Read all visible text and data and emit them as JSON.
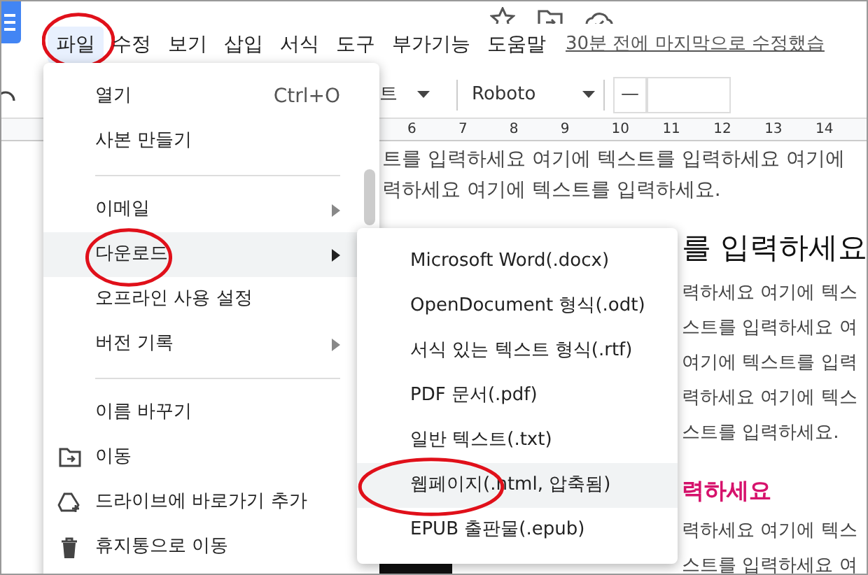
{
  "menubar": {
    "items": [
      {
        "label": "파일",
        "selected": true,
        "circled": true
      },
      {
        "label": "수정",
        "selected": false,
        "circled": false
      },
      {
        "label": "보기",
        "selected": false,
        "circled": false
      },
      {
        "label": "삽입",
        "selected": false,
        "circled": false
      },
      {
        "label": "서식",
        "selected": false,
        "circled": false
      },
      {
        "label": "도구",
        "selected": false,
        "circled": false
      },
      {
        "label": "부가기능",
        "selected": false,
        "circled": false
      },
      {
        "label": "도움말",
        "selected": false,
        "circled": false
      }
    ],
    "last_edit": "30분 전에 마지막으로 수정했습"
  },
  "toolbar": {
    "style_dropdown": "트",
    "font_dropdown": "Roboto",
    "font_size_minus": "—"
  },
  "ruler": [
    "6",
    "7",
    "8",
    "9",
    "10",
    "11",
    "12",
    "13",
    "14"
  ],
  "document": {
    "lines": [
      {
        "kind": "body",
        "text": "트를 입력하세요 여기에 텍스트를 입력하세요 여기에"
      },
      {
        "kind": "body",
        "text": "력하세요 여기에 텍스트를 입력하세요."
      },
      {
        "kind": "heading",
        "text": "를 입력하세요"
      },
      {
        "kind": "side",
        "text": "력하세요 여기에 텍스"
      },
      {
        "kind": "side",
        "text": "스트를 입력하세요 여"
      },
      {
        "kind": "side",
        "text": "여기에 텍스트를 입력"
      },
      {
        "kind": "side",
        "text": "력하세요 여기에 텍스"
      },
      {
        "kind": "side",
        "text": "스트를 입력하세요."
      },
      {
        "kind": "side_heading",
        "text": "력하세요"
      },
      {
        "kind": "side",
        "text": "력하세요 여기에 텍스"
      },
      {
        "kind": "side",
        "text": "스트를 입력하세요 여"
      }
    ]
  },
  "file_menu": {
    "items": [
      {
        "kind": "plain",
        "label": "열기",
        "shortcut": "Ctrl+O",
        "submenu": false,
        "selected": false,
        "circled": false
      },
      {
        "kind": "plain",
        "label": "사본 만들기",
        "submenu": false,
        "selected": false,
        "circled": false
      },
      {
        "kind": "divider"
      },
      {
        "kind": "plain",
        "label": "이메일",
        "submenu": true,
        "selected": false,
        "circled": false
      },
      {
        "kind": "plain",
        "label": "다운로드",
        "submenu": true,
        "selected": true,
        "circled": true
      },
      {
        "kind": "plain",
        "label": "오프라인 사용 설정",
        "submenu": false,
        "selected": false,
        "circled": false
      },
      {
        "kind": "plain",
        "label": "버전 기록",
        "submenu": true,
        "selected": false,
        "circled": false
      },
      {
        "kind": "divider"
      },
      {
        "kind": "plain",
        "label": "이름 바꾸기",
        "submenu": false,
        "selected": false,
        "circled": false
      },
      {
        "kind": "folder",
        "label": "이동",
        "submenu": false,
        "selected": false,
        "circled": false
      },
      {
        "kind": "drive",
        "label": "드라이브에 바로가기 추가",
        "submenu": false,
        "selected": false,
        "circled": false
      },
      {
        "kind": "trash",
        "label": "휴지통으로 이동",
        "submenu": false,
        "selected": false,
        "circled": false
      }
    ]
  },
  "download_menu": {
    "items": [
      {
        "label": "Microsoft Word(.docx)",
        "selected": false,
        "circled": false
      },
      {
        "label": "OpenDocument 형식(.odt)",
        "selected": false,
        "circled": false
      },
      {
        "label": "서식 있는 텍스트 형식(.rtf)",
        "selected": false,
        "circled": false
      },
      {
        "label": "PDF 문서(.pdf)",
        "selected": false,
        "circled": false
      },
      {
        "label": "일반 텍스트(.txt)",
        "selected": false,
        "circled": false
      },
      {
        "label": "웹페이지(.html, 압축됨)",
        "selected": true,
        "circled": true
      },
      {
        "label": "EPUB 출판물(.epub)",
        "selected": false,
        "circled": false
      }
    ]
  }
}
